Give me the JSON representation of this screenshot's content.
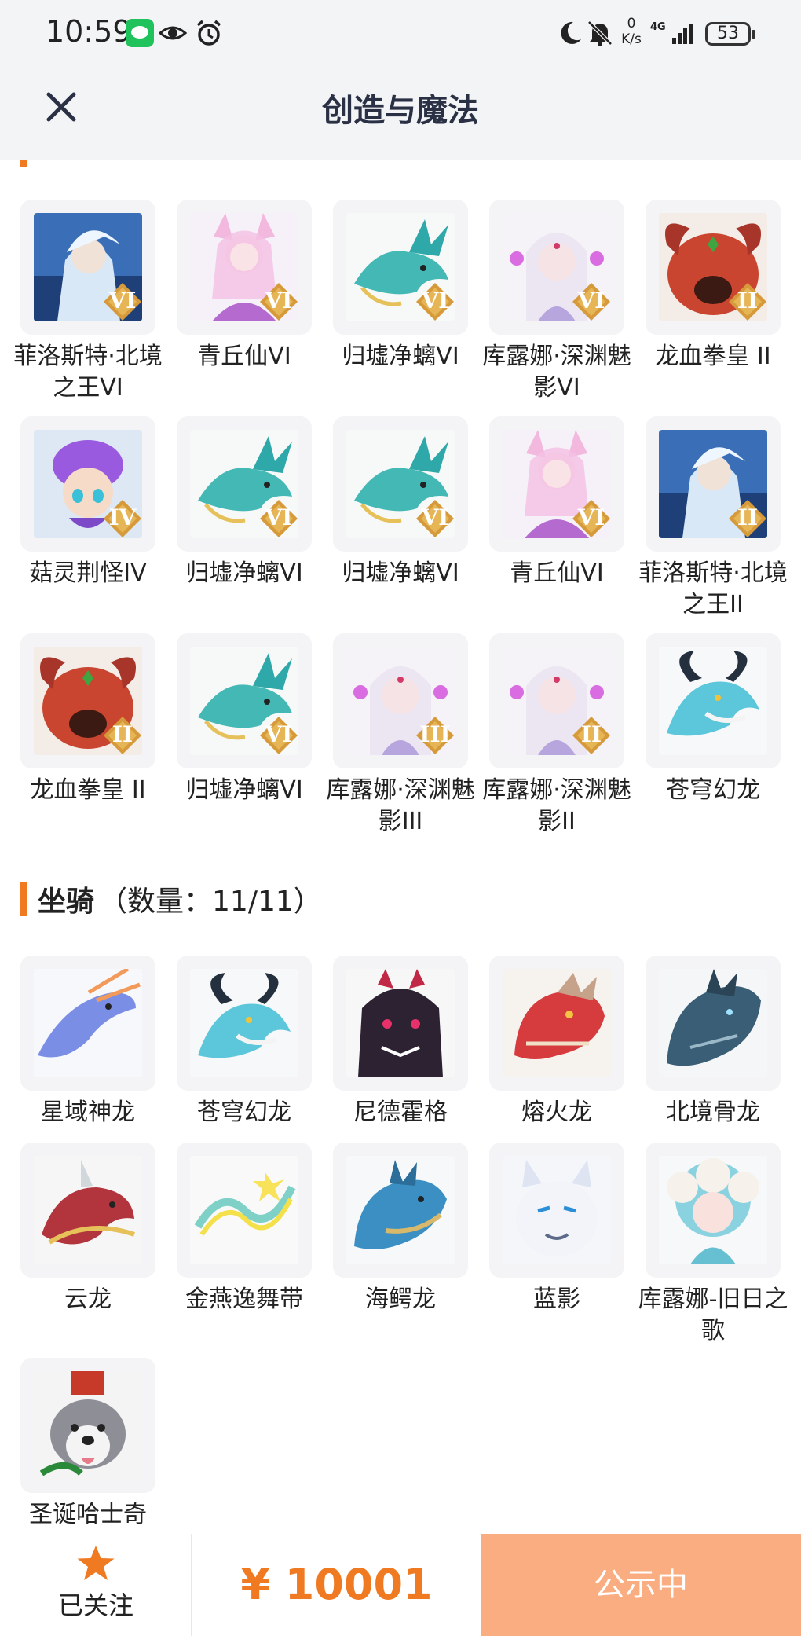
{
  "status_bar": {
    "time": "10:59",
    "net_speed_value": "0",
    "net_speed_unit": "K/s",
    "network": "4G",
    "battery": "53",
    "icons": [
      "wechat-icon",
      "eye-icon",
      "alarm-icon",
      "moon-icon",
      "bell-off-icon",
      "signal-icon"
    ]
  },
  "header": {
    "title": "创造与魔法",
    "close_icon": "close-icon"
  },
  "pets": {
    "items": [
      {
        "name": "菲洛斯特·北境之王VI",
        "badge": "VI",
        "art": "ice-knight"
      },
      {
        "name": "青丘仙VI",
        "badge": "VI",
        "art": "fox-fairy"
      },
      {
        "name": "归墟净螭VI",
        "badge": "VI",
        "art": "jade-dragon"
      },
      {
        "name": "库露娜·深渊魅影VI",
        "badge": "VI",
        "art": "white-witch"
      },
      {
        "name": "龙血拳皇 II",
        "badge": "II",
        "art": "red-beast"
      },
      {
        "name": "菇灵荆怪IV",
        "badge": "IV",
        "art": "mushroom-sprite"
      },
      {
        "name": "归墟净螭VI",
        "badge": "VI",
        "art": "jade-dragon"
      },
      {
        "name": "归墟净螭VI",
        "badge": "VI",
        "art": "jade-dragon"
      },
      {
        "name": "青丘仙VI",
        "badge": "VI",
        "art": "fox-fairy"
      },
      {
        "name": "菲洛斯特·北境之王II",
        "badge": "II",
        "art": "ice-knight"
      },
      {
        "name": "龙血拳皇 II",
        "badge": "II",
        "art": "red-beast"
      },
      {
        "name": "归墟净螭VI",
        "badge": "VI",
        "art": "jade-dragon"
      },
      {
        "name": "库露娜·深渊魅影III",
        "badge": "III",
        "art": "white-witch"
      },
      {
        "name": "库露娜·深渊魅影II",
        "badge": "II",
        "art": "white-witch"
      },
      {
        "name": "苍穹幻龙",
        "badge": "",
        "art": "sky-dragon"
      }
    ]
  },
  "mounts": {
    "title": "坐骑",
    "count": "（数量：11/11）",
    "items": [
      {
        "name": "星域神龙",
        "art": "star-dragon"
      },
      {
        "name": "苍穹幻龙",
        "art": "sky-dragon"
      },
      {
        "name": "尼德霍格",
        "art": "dark-dragon"
      },
      {
        "name": "熔火龙",
        "art": "lava-dragon"
      },
      {
        "name": "北境骨龙",
        "art": "bone-dragon"
      },
      {
        "name": "云龙",
        "art": "cloud-dragon"
      },
      {
        "name": "金燕逸舞带",
        "art": "gold-ribbon"
      },
      {
        "name": "海鳄龙",
        "art": "sea-dragon"
      },
      {
        "name": "蓝影",
        "art": "white-tiger"
      },
      {
        "name": "库露娜-旧日之歌",
        "art": "sheep-girl"
      },
      {
        "name": "圣诞哈士奇",
        "art": "husky"
      }
    ]
  },
  "bottom_bar": {
    "follow_label": "已关注",
    "price": "¥ 10001",
    "status_label": "公示中"
  },
  "colors": {
    "accent": "#f07a22",
    "status_button": "#f9ad80",
    "title_text": "#2b3145"
  }
}
